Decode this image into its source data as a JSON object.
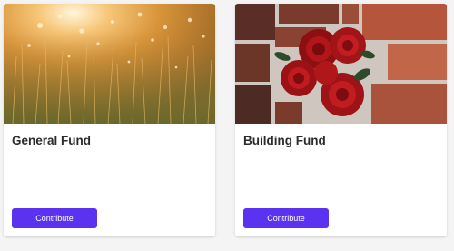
{
  "funds": [
    {
      "title": "General Fund",
      "image": "sunlit-grass-photo",
      "button_label": "Contribute",
      "button_color": "#5a32f0"
    },
    {
      "title": "Building Fund",
      "image": "red-roses-on-brick-wall-photo",
      "button_label": "Contribute",
      "button_color": "#5a32f0"
    }
  ]
}
